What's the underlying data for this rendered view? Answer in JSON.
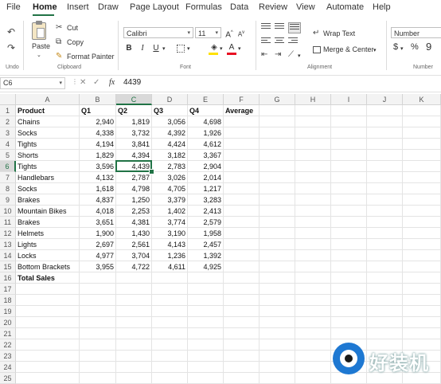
{
  "menu": [
    "File",
    "Home",
    "Insert",
    "Draw",
    "Page Layout",
    "Formulas",
    "Data",
    "Review",
    "View",
    "Automate",
    "Help"
  ],
  "active_tab": "Home",
  "ribbon": {
    "undo_group": "Undo",
    "clipboard": {
      "paste": "Paste",
      "cut": "Cut",
      "copy": "Copy",
      "format_painter": "Format Painter",
      "label": "Clipboard"
    },
    "font": {
      "name": "Calibri",
      "size": "11",
      "label": "Font",
      "bold": "B",
      "italic": "I",
      "underline": "U"
    },
    "alignment": {
      "wrap_text": "Wrap Text",
      "merge_center": "Merge & Center",
      "label": "Alignment"
    },
    "number": {
      "format": "Number",
      "currency": "$",
      "percent": "%",
      "comma": "9",
      "label": "Number"
    }
  },
  "formula_bar": {
    "name_box": "C6",
    "fx": "fx",
    "value": "4439"
  },
  "columns": [
    "A",
    "B",
    "C",
    "D",
    "E",
    "F",
    "G",
    "H",
    "I",
    "J",
    "K"
  ],
  "selected_column": "C",
  "selected_row": "6",
  "rows": [
    [
      "Product",
      "Q1",
      "Q2",
      "Q3",
      "Q4",
      "Average"
    ],
    [
      "Chains",
      "2,940",
      "1,819",
      "3,056",
      "4,698",
      ""
    ],
    [
      "Socks",
      "4,338",
      "3,732",
      "4,392",
      "1,926",
      ""
    ],
    [
      "Tights",
      "4,194",
      "3,841",
      "4,424",
      "4,612",
      ""
    ],
    [
      "Shorts",
      "1,829",
      "4,394",
      "3,182",
      "3,367",
      ""
    ],
    [
      "Tights",
      "3,596",
      "4,439",
      "2,783",
      "2,904",
      ""
    ],
    [
      "Handlebars",
      "4,132",
      "2,787",
      "3,026",
      "2,014",
      ""
    ],
    [
      "Socks",
      "1,618",
      "4,798",
      "4,705",
      "1,217",
      ""
    ],
    [
      "Brakes",
      "4,837",
      "1,250",
      "3,379",
      "3,283",
      ""
    ],
    [
      "Mountain Bikes",
      "4,018",
      "2,253",
      "1,402",
      "2,413",
      ""
    ],
    [
      "Brakes",
      "3,651",
      "4,381",
      "3,774",
      "2,579",
      ""
    ],
    [
      "Helmets",
      "1,900",
      "1,430",
      "3,190",
      "1,958",
      ""
    ],
    [
      "Lights",
      "2,697",
      "2,561",
      "4,143",
      "2,457",
      ""
    ],
    [
      "Locks",
      "4,977",
      "3,704",
      "1,236",
      "1,392",
      ""
    ],
    [
      "Bottom Brackets",
      "3,955",
      "4,722",
      "4,611",
      "4,925",
      ""
    ],
    [
      "Total Sales",
      "",
      "",
      "",
      "",
      ""
    ]
  ],
  "row_count": 25,
  "watermark": "好装机",
  "colors": {
    "accent": "#217346",
    "watermark_blue": "#1e78d2"
  }
}
